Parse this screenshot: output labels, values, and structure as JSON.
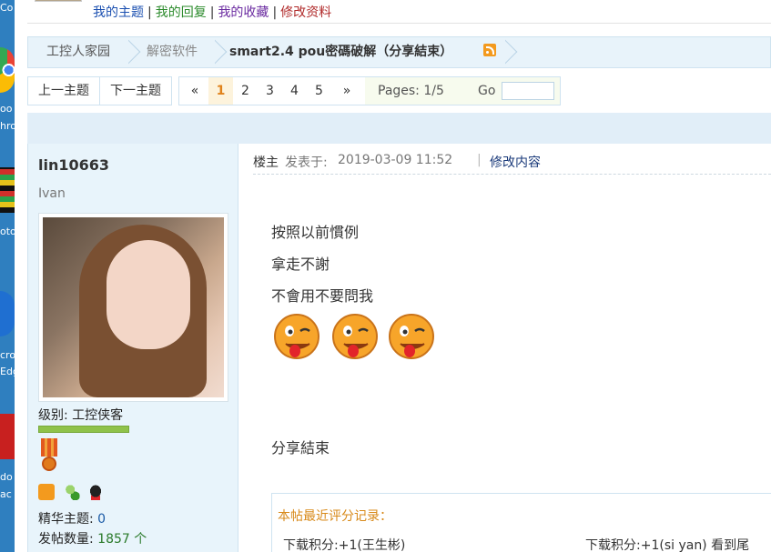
{
  "desktop": {
    "labels": [
      "Co",
      "oo",
      "hro",
      "oto",
      "cro",
      "Edg",
      "do",
      "ac"
    ]
  },
  "topbar": {
    "links": [
      {
        "label": "我的主题",
        "color": "#1a4fb0"
      },
      {
        "label": "我的回复",
        "color": "#2a8a2a"
      },
      {
        "label": "我的收藏",
        "color": "#6a2aa0"
      },
      {
        "label": "修改资料",
        "color": "#b02a2a"
      }
    ],
    "separator": "|"
  },
  "breadcrumb": {
    "home": "工控人家园",
    "forum": "解密软件",
    "title": "smart2.4 pou密碼破解（分享結束）",
    "rss_icon": "rss-icon"
  },
  "pager": {
    "prev_thread": "上一主题",
    "next_thread": "下一主题",
    "first": "«",
    "pages": [
      "1",
      "2",
      "3",
      "4",
      "5"
    ],
    "current": "1",
    "last": "»",
    "pages_text": "Pages: 1/5",
    "go_label": "Go",
    "go_value": ""
  },
  "author": {
    "name": "lin10663",
    "title": "Ivan",
    "level_label": "级别: 工控侠客",
    "essence_label": "精华主题:",
    "essence_value": "0",
    "posts_label": "发帖数量:",
    "posts_value": "1857 个"
  },
  "post": {
    "floor": "楼主",
    "posted_label": "发表于:",
    "posted_time": "2019-03-09 11:52",
    "separator": "|",
    "edit_label": "修改内容",
    "lines": [
      "按照以前慣例",
      "拿走不謝",
      "不會用不要問我"
    ],
    "closing": "分享結束",
    "rating_title": "本帖最近评分记录：",
    "rating_items": [
      "下载积分:+1(王生彬)",
      "下载积分:+1(si yan) 看到尾"
    ]
  }
}
